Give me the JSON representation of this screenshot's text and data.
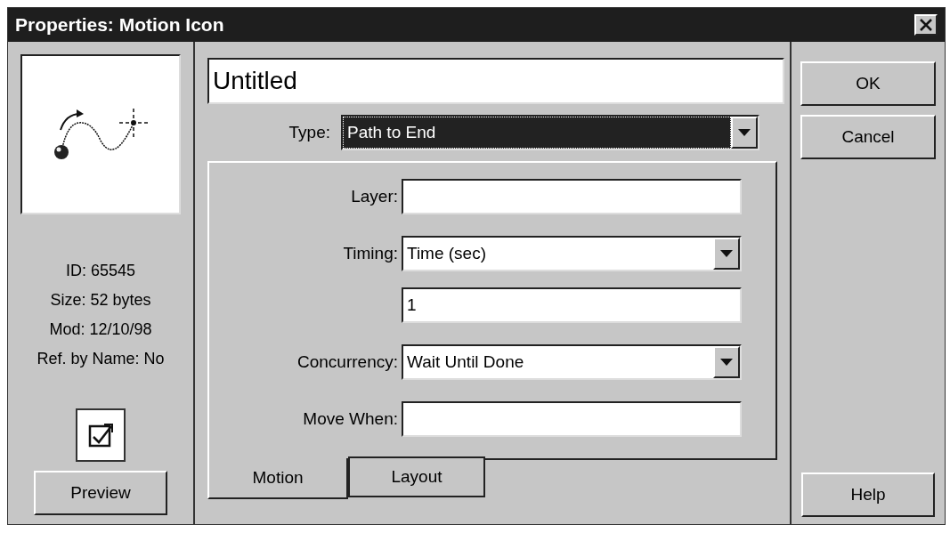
{
  "window": {
    "title": "Properties: Motion Icon"
  },
  "info": [
    "ID: 65545",
    "Size: 52 bytes",
    "Mod: 12/10/98",
    "Ref. by Name: No"
  ],
  "preview_button": "Preview",
  "name_field": {
    "value": "Untitled"
  },
  "type_field": {
    "label": "Type:",
    "value": "Path to End",
    "focused": true
  },
  "fields": [
    {
      "kind": "text",
      "label": "Layer:"
    },
    {
      "kind": "dropdown",
      "label": "Timing:",
      "value": "Time (sec)"
    },
    {
      "kind": "text",
      "value": "1"
    },
    {
      "kind": "dropdown",
      "label": "Concurrency:",
      "value": "Wait Until Done"
    },
    {
      "kind": "text",
      "label": "Move When:"
    }
  ],
  "tabs": [
    {
      "label": "Motion",
      "selected": true
    },
    {
      "label": "Layout",
      "selected": false
    }
  ],
  "buttons": [
    "OK",
    "Cancel"
  ],
  "help_button": "Help"
}
